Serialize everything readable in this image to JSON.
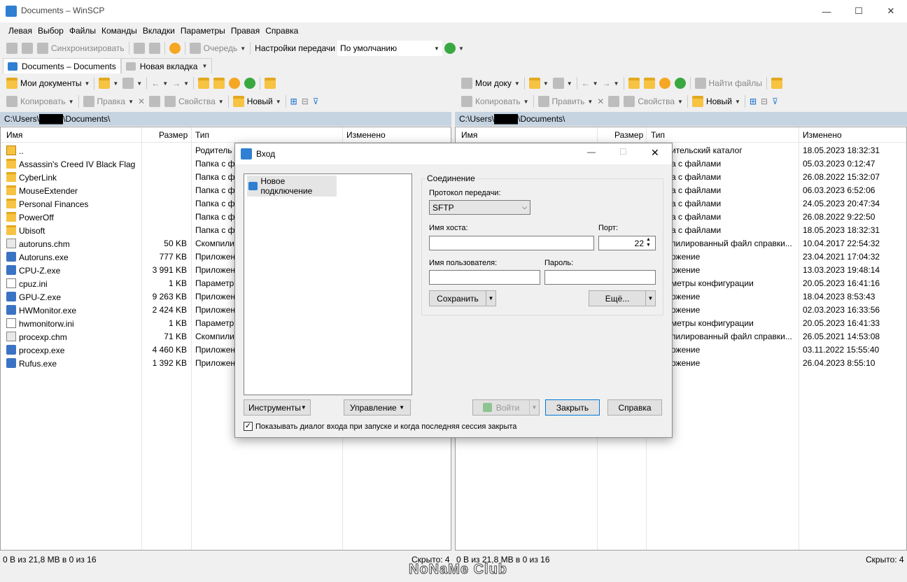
{
  "window": {
    "title": "Documents – WinSCP",
    "min": "—",
    "max": "☐",
    "close": "✕"
  },
  "menu": [
    "Левая",
    "Выбор",
    "Файлы",
    "Команды",
    "Вкладки",
    "Параметры",
    "Правая",
    "Справка"
  ],
  "toolbar": {
    "sync": "Синхронизировать",
    "queue": "Очередь",
    "transfer_label": "Настройки передачи",
    "transfer_value": "По умолчанию"
  },
  "tabs": {
    "tab1": "Documents – Documents",
    "tab2": "Новая вкладка"
  },
  "left": {
    "location": "Мои документы",
    "toolbar": {
      "copy": "Копировать",
      "edit": "Правка",
      "props": "Свойства",
      "new": "Новый"
    },
    "path": "C:\\Users\\████\\Documents\\",
    "cols": {
      "name": "Имя",
      "size": "Размер",
      "type": "Тип",
      "changed": "Изменено"
    },
    "status": "0 B из 21,8 MB в 0 из 16",
    "hidden": "Скрыто: 4"
  },
  "right": {
    "location": "Мои доку",
    "toolbar": {
      "copy": "Копировать",
      "edit": "Править",
      "props": "Свойства",
      "new": "Новый",
      "find": "Найти файлы"
    },
    "path": "C:\\Users\\████\\Documents\\",
    "cols": {
      "name": "Имя",
      "size": "Размер",
      "type": "Тип",
      "changed": "Изменено"
    },
    "status": "0 B из 21,8 MB в 0 из 16",
    "hidden": "Скрыто: 4"
  },
  "files": [
    {
      "name": "..",
      "size": "",
      "ltype": "Родитель",
      "rtype": "ительский каталог",
      "date": "18.05.2023 18:32:31",
      "icon": "up"
    },
    {
      "name": "Assassin's Creed IV Black Flag",
      "size": "",
      "ltype": "Папка с фа",
      "rtype": "а с файлами",
      "date": "05.03.2023 0:12:47",
      "icon": "folder"
    },
    {
      "name": "CyberLink",
      "size": "",
      "ltype": "Папка с фа",
      "rtype": "а с файлами",
      "date": "26.08.2022 15:32:07",
      "icon": "folder"
    },
    {
      "name": "MouseExtender",
      "size": "",
      "ltype": "Папка с фа",
      "rtype": "а с файлами",
      "date": "06.03.2023 6:52:06",
      "icon": "folder"
    },
    {
      "name": "Personal Finances",
      "size": "",
      "ltype": "Папка с фа",
      "rtype": "а с файлами",
      "date": "24.05.2023 20:47:34",
      "icon": "folder"
    },
    {
      "name": "PowerOff",
      "size": "",
      "ltype": "Папка с фа",
      "rtype": "а с файлами",
      "date": "26.08.2022 9:22:50",
      "icon": "folder"
    },
    {
      "name": "Ubisoft",
      "size": "",
      "ltype": "Папка с фа",
      "rtype": "а с файлами",
      "date": "18.05.2023 18:32:31",
      "icon": "folder"
    },
    {
      "name": "autoruns.chm",
      "size": "50 KB",
      "ltype": "Скомпили",
      "rtype": "пилированный файл справки...",
      "date": "10.04.2017 22:54:32",
      "icon": "chm"
    },
    {
      "name": "Autoruns.exe",
      "size": "777 KB",
      "ltype": "Приложен",
      "rtype": "ожение",
      "date": "23.04.2021 17:04:32",
      "icon": "exe"
    },
    {
      "name": "CPU-Z.exe",
      "size": "3 991 KB",
      "ltype": "Приложен",
      "rtype": "ожение",
      "date": "13.03.2023 19:48:14",
      "icon": "exe"
    },
    {
      "name": "cpuz.ini",
      "size": "1 KB",
      "ltype": "Параметр",
      "rtype": "метры конфигурации",
      "date": "20.05.2023 16:41:16",
      "icon": "ini"
    },
    {
      "name": "GPU-Z.exe",
      "size": "9 263 KB",
      "ltype": "Приложен",
      "rtype": "ожение",
      "date": "18.04.2023 8:53:43",
      "icon": "exe"
    },
    {
      "name": "HWMonitor.exe",
      "size": "2 424 KB",
      "ltype": "Приложен",
      "rtype": "ожение",
      "date": "02.03.2023 16:33:56",
      "icon": "exe"
    },
    {
      "name": "hwmonitorw.ini",
      "size": "1 KB",
      "ltype": "Параметр",
      "rtype": "метры конфигурации",
      "date": "20.05.2023 16:41:33",
      "icon": "ini"
    },
    {
      "name": "procexp.chm",
      "size": "71 KB",
      "ltype": "Скомпили",
      "rtype": "пилированный файл справки...",
      "date": "26.05.2021 14:53:08",
      "icon": "chm"
    },
    {
      "name": "procexp.exe",
      "size": "4 460 KB",
      "ltype": "Приложен",
      "rtype": "ожение",
      "date": "03.11.2022 15:55:40",
      "icon": "exe"
    },
    {
      "name": "Rufus.exe",
      "size": "1 392 KB",
      "ltype": "Приложен",
      "rtype": "ожение",
      "date": "26.04.2023 8:55:10",
      "icon": "exe"
    }
  ],
  "dialog": {
    "title": "Вход",
    "site": "Новое подключение",
    "group": "Соединение",
    "protocol_label": "Протокол передачи:",
    "protocol": "SFTP",
    "host_label": "Имя хоста:",
    "host": "",
    "port_label": "Порт:",
    "port": "22",
    "user_label": "Имя пользователя:",
    "user": "",
    "pass_label": "Пароль:",
    "pass": "",
    "save": "Сохранить",
    "more": "Ещё...",
    "tools": "Инструменты",
    "manage": "Управление",
    "login": "Войти",
    "close": "Закрыть",
    "help": "Справка",
    "checkbox": "Показывать диалог входа при запуске и когда последняя сессия закрыта",
    "checked": true
  },
  "watermark": "NoNaMe Club"
}
